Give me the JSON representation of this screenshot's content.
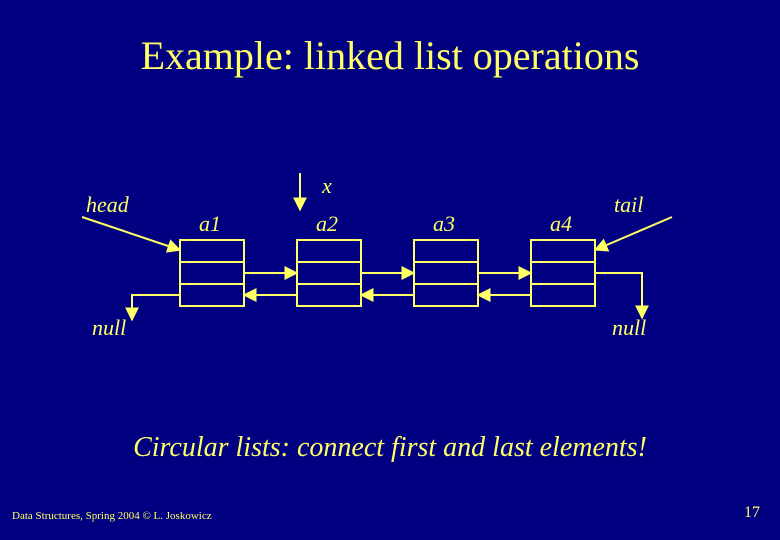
{
  "title": "Example: linked list operations",
  "labels": {
    "head": "head",
    "tail": "tail",
    "x": "x",
    "null_left": "null",
    "null_right": "null"
  },
  "nodes": [
    "a1",
    "a2",
    "a3",
    "a4"
  ],
  "caption": "Circular lists: connect first and last elements!",
  "footer": "Data Structures, Spring 2004 © L. Joskowicz",
  "page_number": "17"
}
